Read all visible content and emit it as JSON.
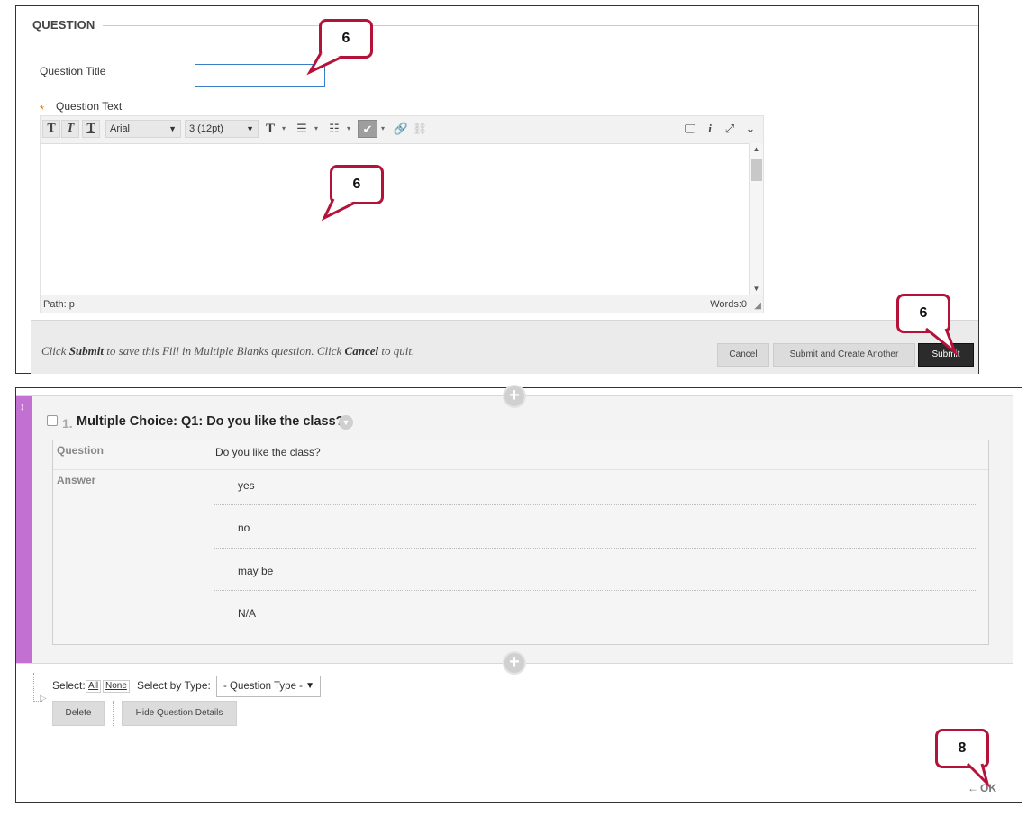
{
  "question_form": {
    "section_heading": "QUESTION",
    "title_label": "Question Title",
    "title_value": "",
    "required_marker": "*",
    "text_label": "Question Text",
    "toolbar": {
      "font_family": "Arial",
      "font_size": "3 (12pt)"
    },
    "path_label": "Path: p",
    "words_label": "Words:0",
    "submit_hint": {
      "part1": "Click ",
      "submit_word": "Submit",
      "part2": " to save this Fill in Multiple Blanks question. Click ",
      "cancel_word": "Cancel",
      "part3": " to quit."
    },
    "buttons": {
      "cancel": "Cancel",
      "submit_another": "Submit and Create Another",
      "submit": "Submit"
    }
  },
  "callouts": [
    "6",
    "6",
    "6",
    "8"
  ],
  "question_list": {
    "question": {
      "number": "1.",
      "title": "Multiple Choice: Q1: Do you like the class?",
      "question_label": "Question",
      "question_text": "Do you like the class?",
      "answer_label": "Answer",
      "answers": [
        "yes",
        "no",
        "may be",
        "N/A"
      ]
    },
    "select_label": "Select:",
    "select_all": "All",
    "select_none": "None",
    "select_by_type_label": "Select by Type:",
    "question_type_placeholder": "- Question Type -",
    "delete_button": "Delete",
    "hide_details_button": "Hide Question Details",
    "ok_label": "OK"
  },
  "colors": {
    "callout_border": "#b5123a",
    "drag_handle": "#c270d2",
    "submit_button": "#2b2b2b"
  }
}
